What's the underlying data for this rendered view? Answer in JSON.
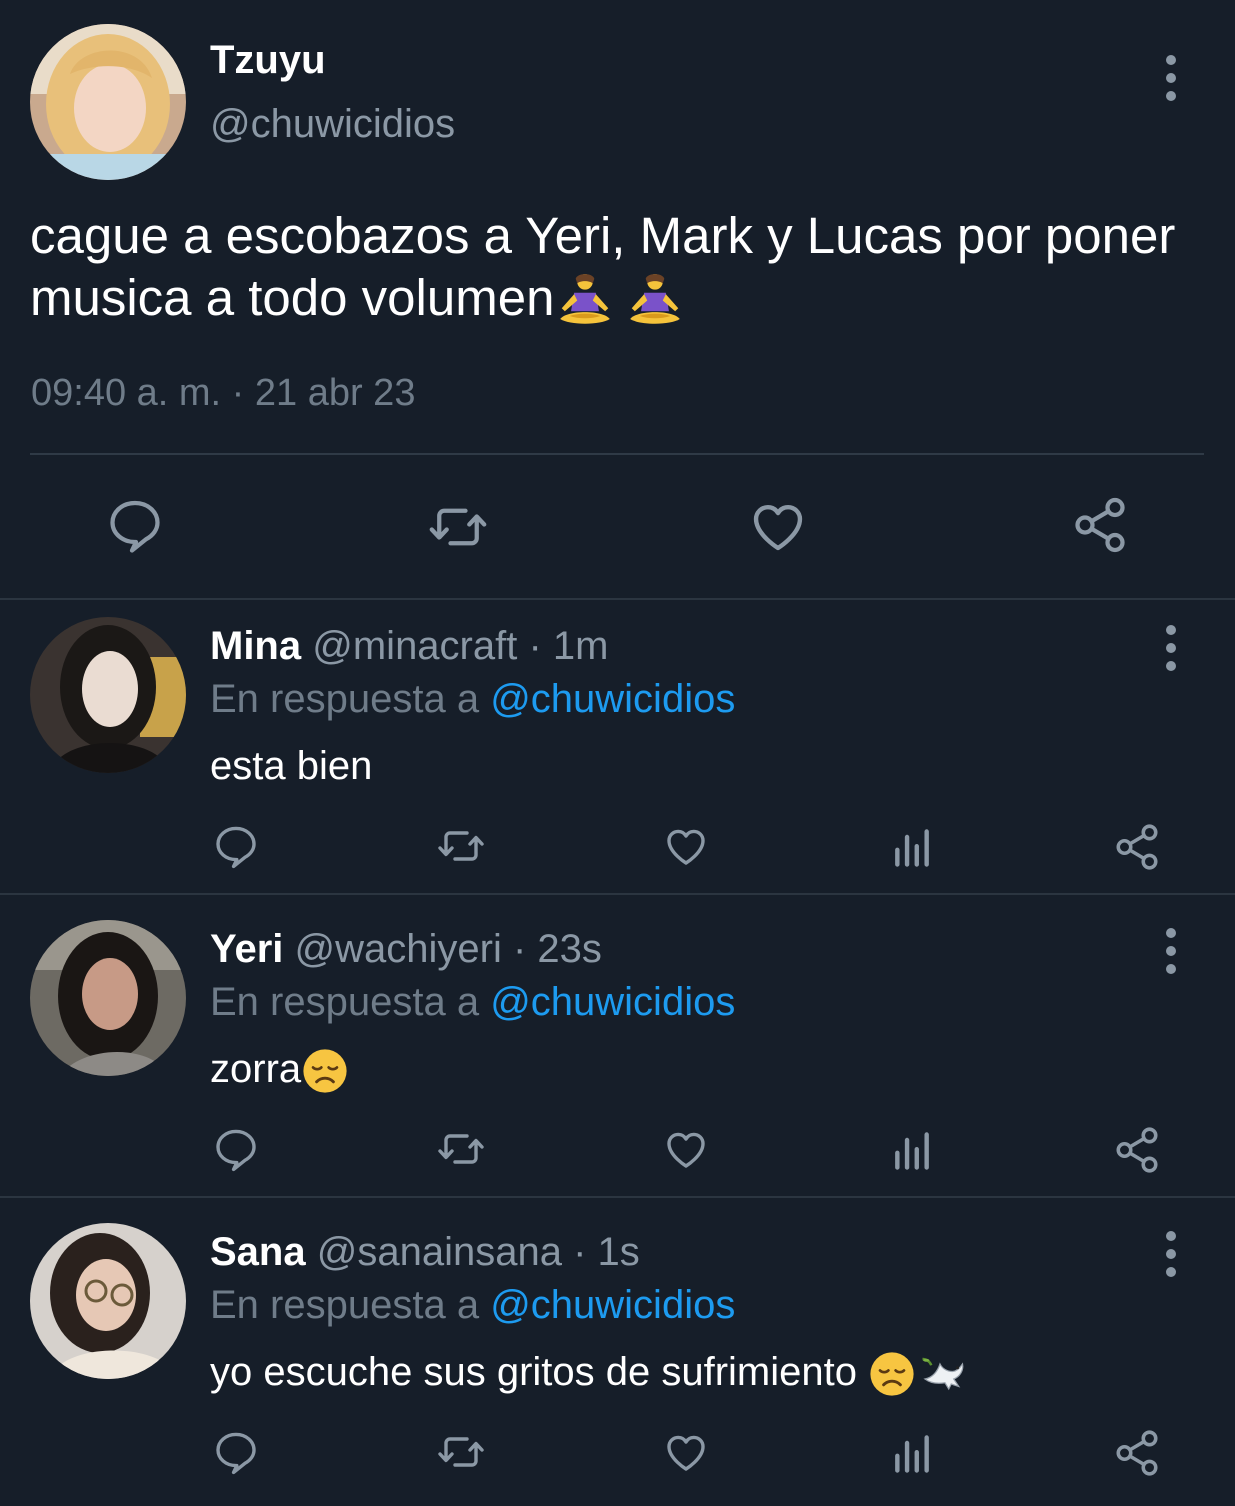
{
  "main_tweet": {
    "name": "Tzuyu",
    "handle": "@chuwicidios",
    "text": "cague a escobazos a Yeri, Mark y Lucas por poner musica a todo volumen",
    "emojis": [
      "woman-in-lotus-position",
      "woman-in-lotus-position"
    ],
    "timestamp": "09:40 a. m. · 21 abr 23",
    "actions": [
      "reply-icon",
      "retweet-icon",
      "like-icon",
      "share-icon"
    ]
  },
  "replies": [
    {
      "name": "Mina",
      "handle": "@minacraft",
      "time": "· 1m",
      "in_reply_prefix": "En respuesta a",
      "in_reply_handle": "@chuwicidios",
      "text": "esta bien",
      "emojis": []
    },
    {
      "name": "Yeri",
      "handle": "@wachiyeri",
      "time": "· 23s",
      "in_reply_prefix": "En respuesta a",
      "in_reply_handle": "@chuwicidios",
      "text": "zorra",
      "emojis": [
        "disappointed-face"
      ]
    },
    {
      "name": "Sana",
      "handle": "@sanainsana",
      "time": "· 1s",
      "in_reply_prefix": "En respuesta a",
      "in_reply_handle": "@chuwicidios",
      "text": "yo escuche sus gritos de sufrimiento ",
      "emojis": [
        "disappointed-face",
        "dove"
      ]
    }
  ],
  "reply_actions": [
    "reply-icon",
    "retweet-icon",
    "like-icon",
    "views-icon",
    "share-icon"
  ],
  "colors": {
    "background": "#161e29",
    "link": "#1d9bf0",
    "secondary_text": "#8b98a5"
  }
}
